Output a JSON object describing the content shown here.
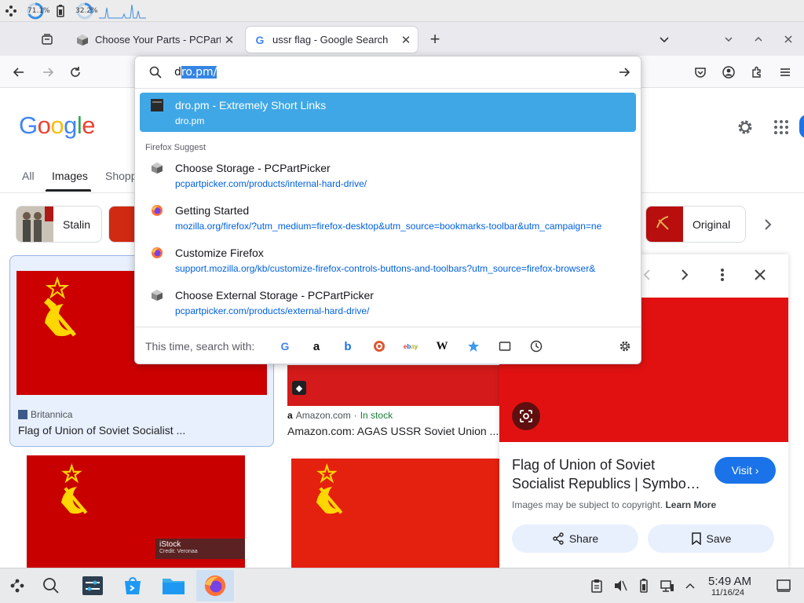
{
  "system_bar": {
    "cpu_percent": "71.1%",
    "mem_percent": "32.2%"
  },
  "tabs": [
    {
      "title": "Choose Your Parts - PCPartPicker",
      "active": false
    },
    {
      "title": "ussr flag - Google Search",
      "active": true
    }
  ],
  "url_bar": {
    "typed_prefix": "d",
    "autofill_selection": "ro.pm/",
    "suggestions_selected": {
      "title": "dro.pm - Extremely Short Links",
      "url": "dro.pm"
    },
    "section_label": "Firefox Suggest",
    "suggestions": [
      {
        "title": "Choose Storage - PCPartPicker",
        "url": "pcpartpicker.com/products/internal-hard-drive/",
        "icon": "pcpartpicker-icon"
      },
      {
        "title": "Getting Started",
        "url": "mozilla.org/firefox/?utm_medium=firefox-desktop&utm_source=bookmarks-toolbar&utm_campaign=ne",
        "icon": "firefox-icon"
      },
      {
        "title": "Customize Firefox",
        "url": "support.mozilla.org/kb/customize-firefox-controls-buttons-and-toolbars?utm_source=firefox-browser&",
        "icon": "firefox-icon"
      },
      {
        "title": "Choose External Storage - PCPartPicker",
        "url": "pcpartpicker.com/products/external-hard-drive/",
        "icon": "pcpartpicker-icon"
      }
    ],
    "search_with_label": "This time, search with:",
    "engines": [
      {
        "name": "google-engine-icon",
        "glyph": "G",
        "color": "#4285f4"
      },
      {
        "name": "amazon-engine-icon",
        "glyph": "a",
        "color": "#111111"
      },
      {
        "name": "bing-engine-icon",
        "glyph": "b",
        "color": "#1a73e8"
      },
      {
        "name": "duckduckgo-engine-icon",
        "glyph": "D",
        "color": "#de5833"
      },
      {
        "name": "ebay-engine-icon",
        "glyph": "ebay",
        "color": "#e53238"
      },
      {
        "name": "wikipedia-engine-icon",
        "glyph": "W",
        "color": "#111111"
      }
    ]
  },
  "google": {
    "logo": "Google",
    "tabs": [
      "All",
      "Images",
      "Shopp"
    ],
    "chips": [
      {
        "label": "Stalin"
      },
      {
        "label": "Original"
      }
    ],
    "results": [
      {
        "source": "Britannica",
        "title": "Flag of Union of Soviet Socialist ..."
      },
      {
        "source": "Amazon.com",
        "stock": "In stock",
        "title": "Amazon.com: AGAS USSR Soviet Union ..."
      }
    ],
    "istock_label": "iStock",
    "istock_credit": "Credit: Veronaa",
    "panel": {
      "title": "Flag of Union of Soviet Socialist Republics | Symbo…",
      "visit_label": "Visit",
      "copyright_note": "Images may be subject to copyright.",
      "learn_more": "Learn More",
      "share_label": "Share",
      "save_label": "Save"
    }
  },
  "taskbar": {
    "time": "5:49 AM",
    "date": "11/16/24"
  },
  "colors": {
    "flag_red": "#cc0000",
    "flag_gold": "#ffd700",
    "selected_suggestion": "#3fa7e6",
    "link_blue": "#0061e0",
    "google_blue": "#1a73e8"
  }
}
